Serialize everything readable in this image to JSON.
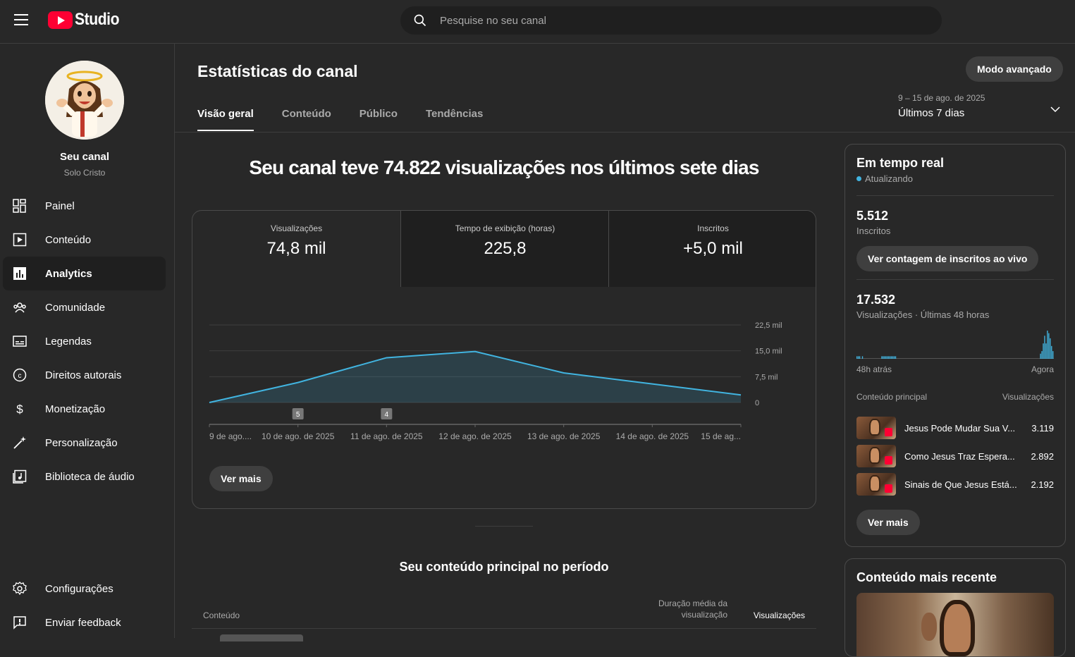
{
  "header": {
    "logo_text": "Studio",
    "search_placeholder": "Pesquise no seu canal"
  },
  "sidebar": {
    "channel_name": "Seu canal",
    "channel_handle": "Solo Cristo",
    "items": [
      {
        "label": "Painel",
        "icon": "dashboard-icon"
      },
      {
        "label": "Conteúdo",
        "icon": "content-icon"
      },
      {
        "label": "Analytics",
        "icon": "analytics-icon",
        "active": true
      },
      {
        "label": "Comunidade",
        "icon": "community-icon"
      },
      {
        "label": "Legendas",
        "icon": "subtitles-icon"
      },
      {
        "label": "Direitos autorais",
        "icon": "copyright-icon"
      },
      {
        "label": "Monetização",
        "icon": "dollar-icon"
      },
      {
        "label": "Personalização",
        "icon": "magic-wand-icon"
      },
      {
        "label": "Biblioteca de áudio",
        "icon": "audio-library-icon"
      }
    ],
    "bottom_items": [
      {
        "label": "Configurações",
        "icon": "gear-icon"
      },
      {
        "label": "Enviar feedback",
        "icon": "feedback-icon"
      }
    ]
  },
  "main": {
    "title": "Estatísticas do canal",
    "advanced_button": "Modo avançado",
    "tabs": [
      "Visão geral",
      "Conteúdo",
      "Público",
      "Tendências"
    ],
    "date_range": {
      "dates": "9 – 15 de ago. de 2025",
      "label": "Últimos 7 dias"
    },
    "headline": "Seu canal teve 74.822 visualizações nos últimos sete dias",
    "metrics": [
      {
        "label": "Visualizações",
        "value": "74,8 mil"
      },
      {
        "label": "Tempo de exibição (horas)",
        "value": "225,8"
      },
      {
        "label": "Inscritos",
        "value": "+5,0 mil"
      }
    ],
    "see_more": "Ver mais",
    "top_content_title": "Seu conteúdo principal no período",
    "table_headers": {
      "content": "Conteúdo",
      "avg_duration": "Duração média da visualização",
      "views": "Visualizações"
    }
  },
  "chart_data": {
    "type": "area",
    "x": [
      "9 de ago....",
      "10 de ago. de 2025",
      "11 de ago. de 2025",
      "12 de ago. de 2025",
      "13 de ago. de 2025",
      "14 de ago. de 2025",
      "15 de ag..."
    ],
    "series": [
      {
        "values": [
          0,
          5800,
          13000,
          14800,
          8600,
          5400,
          2200
        ]
      }
    ],
    "yticks": [
      "22,5 mil",
      "15,0 mil",
      "7,5 mil",
      "0"
    ],
    "ylim": [
      0,
      22500
    ],
    "markers": [
      {
        "x_index": 1,
        "label": "5"
      },
      {
        "x_index": 2,
        "label": "4"
      }
    ],
    "color": "#41b4e0"
  },
  "realtime": {
    "title": "Em tempo real",
    "status": "Atualizando",
    "subscribers_value": "5.512",
    "subscribers_label": "Inscritos",
    "live_button": "Ver contagem de inscritos ao vivo",
    "views_value": "17.532",
    "views_label": "Visualizações · Últimas 48 horas",
    "axis_start": "48h atrás",
    "axis_end": "Agora",
    "col_content": "Conteúdo principal",
    "col_views": "Visualizações",
    "bars": [
      1,
      1,
      1,
      0,
      1,
      0,
      0,
      0,
      0,
      0,
      0,
      0,
      0,
      0,
      0,
      0,
      0,
      0,
      1,
      1,
      1,
      1,
      1,
      1,
      1,
      1,
      1,
      1,
      1,
      0,
      0,
      0,
      0,
      0,
      0,
      0,
      0,
      0,
      0,
      0,
      0,
      0,
      0,
      0,
      0,
      0,
      0,
      0,
      0,
      0,
      0,
      0,
      0,
      0,
      0,
      0,
      0,
      0,
      0,
      0,
      0,
      0,
      0,
      0,
      0,
      0,
      0,
      0,
      0,
      0,
      0,
      0,
      0,
      0,
      0,
      0,
      0,
      0,
      0,
      0,
      0,
      0,
      0,
      0,
      0,
      0,
      0,
      0,
      0,
      0,
      0,
      0,
      0,
      0,
      0,
      0,
      0,
      0,
      0,
      0,
      0,
      0,
      0,
      0,
      0,
      0,
      0,
      0,
      0,
      0,
      0,
      0,
      0,
      0,
      0,
      0,
      0,
      0,
      0,
      0,
      0,
      0,
      0,
      0,
      0,
      0,
      0,
      0,
      0,
      0,
      0,
      0,
      0,
      2,
      3,
      6,
      9,
      6,
      11,
      10,
      8,
      5,
      3
    ],
    "top_content": [
      {
        "title": "Jesus Pode Mudar Sua V...",
        "views": "3.119"
      },
      {
        "title": "Como Jesus Traz Espera...",
        "views": "2.892"
      },
      {
        "title": "Sinais de Que Jesus Está...",
        "views": "2.192"
      }
    ],
    "see_more": "Ver mais"
  },
  "recent": {
    "title": "Conteúdo mais recente"
  }
}
